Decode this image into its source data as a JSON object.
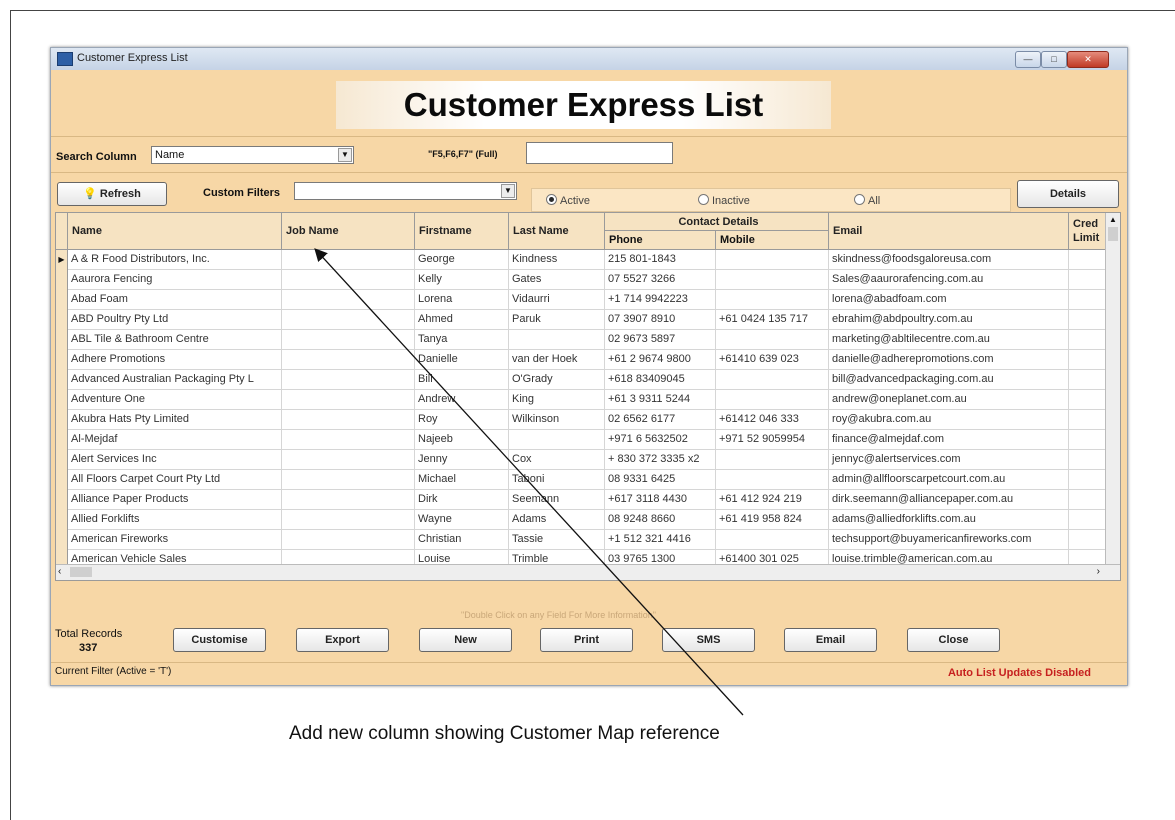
{
  "window": {
    "title": "Customer Express List",
    "header": "Customer Express List",
    "controls": {
      "minimize": "—",
      "maximize": "□",
      "close": "✕"
    }
  },
  "search": {
    "label": "Search Column",
    "column_value": "Name",
    "fkeys_label": "\"F5,F6,F7\" (Full)",
    "text_value": ""
  },
  "toolbar": {
    "refresh_label": "Refresh",
    "custom_filters_label": "Custom Filters",
    "custom_filters_value": "",
    "details_label": "Details"
  },
  "filter_radio": {
    "options": [
      "Active",
      "Inactive",
      "All"
    ],
    "selected": "Active"
  },
  "grid": {
    "columns": {
      "name": "Name",
      "job_name": "Job Name",
      "firstname": "Firstname",
      "last_name": "Last Name",
      "contact_details": "Contact Details",
      "phone": "Phone",
      "mobile": "Mobile",
      "email": "Email",
      "credit_limit": "Cred Limit"
    },
    "rows": [
      {
        "name": "A & R Food Distributors, Inc.",
        "job": "",
        "first": "George",
        "last": "Kindness",
        "phone": "215 801-1843",
        "mobile": "",
        "email": "skindness@foodsgaloreusa.com"
      },
      {
        "name": "Aaurora Fencing",
        "job": "",
        "first": "Kelly",
        "last": "Gates",
        "phone": "07 5527 3266",
        "mobile": "",
        "email": "Sales@aaurorafencing.com.au"
      },
      {
        "name": "Abad Foam",
        "job": "",
        "first": "Lorena",
        "last": "Vidaurri",
        "phone": "+1 714 9942223",
        "mobile": "",
        "email": "lorena@abadfoam.com"
      },
      {
        "name": "ABD Poultry Pty Ltd",
        "job": "",
        "first": "Ahmed",
        "last": "Paruk",
        "phone": "07 3907 8910",
        "mobile": "+61 0424 135 717",
        "email": "ebrahim@abdpoultry.com.au"
      },
      {
        "name": "ABL Tile & Bathroom Centre",
        "job": "",
        "first": "Tanya",
        "last": "",
        "phone": "02 9673 5897",
        "mobile": "",
        "email": "marketing@abltilecentre.com.au"
      },
      {
        "name": "Adhere Promotions",
        "job": "",
        "first": "Danielle",
        "last": "van der Hoek",
        "phone": "+61 2 9674 9800",
        "mobile": "+61410 639 023",
        "email": "danielle@adherepromotions.com"
      },
      {
        "name": "Advanced Australian Packaging Pty L",
        "job": "",
        "first": "Bill",
        "last": "O'Grady",
        "phone": "+618 83409045",
        "mobile": "",
        "email": "bill@advancedpackaging.com.au"
      },
      {
        "name": "Adventure One",
        "job": "",
        "first": "Andrew",
        "last": "King",
        "phone": "+61 3 9311 5244",
        "mobile": "",
        "email": "andrew@oneplanet.com.au"
      },
      {
        "name": "Akubra Hats Pty Limited",
        "job": "",
        "first": "Roy",
        "last": "Wilkinson",
        "phone": "02 6562 6177",
        "mobile": "+61412 046 333",
        "email": "roy@akubra.com.au"
      },
      {
        "name": "Al-Mejdaf",
        "job": "",
        "first": "Najeeb",
        "last": "",
        "phone": "+971 6 5632502",
        "mobile": "+971 52 9059954",
        "email": "finance@almejdaf.com"
      },
      {
        "name": "Alert Services Inc",
        "job": "",
        "first": "Jenny",
        "last": "Cox",
        "phone": "+ 830 372 3335 x2",
        "mobile": "",
        "email": "jennyc@alertservices.com"
      },
      {
        "name": "All Floors Carpet Court Pty Ltd",
        "job": "",
        "first": "Michael",
        "last": "Taboni",
        "phone": "08 9331 6425",
        "mobile": "",
        "email": "admin@allfloorscarpetcourt.com.au"
      },
      {
        "name": "Alliance Paper Products",
        "job": "",
        "first": "Dirk",
        "last": "Seemann",
        "phone": "+617 3118 4430",
        "mobile": "+61 412 924 219",
        "email": "dirk.seemann@alliancepaper.com.au"
      },
      {
        "name": "Allied Forklifts",
        "job": "",
        "first": "Wayne",
        "last": "Adams",
        "phone": "08 9248 8660",
        "mobile": "+61 419 958 824",
        "email": "adams@alliedforklifts.com.au"
      },
      {
        "name": "American Fireworks",
        "job": "",
        "first": "Christian",
        "last": "Tassie",
        "phone": "+1 512 321 4416",
        "mobile": "",
        "email": "techsupport@buyamericanfireworks.com"
      },
      {
        "name": "American Vehicle Sales",
        "job": "",
        "first": "Louise",
        "last": "Trimble",
        "phone": "03 9765 1300",
        "mobile": "+61400 301 025",
        "email": "louise.trimble@american.com.au"
      }
    ]
  },
  "hint": "\"Double Click on any Field For More Information\"",
  "totals": {
    "label": "Total Records",
    "value": "337"
  },
  "buttons": {
    "customise": "Customise",
    "export": "Export",
    "new": "New",
    "print": "Print",
    "sms": "SMS",
    "email": "Email",
    "close": "Close"
  },
  "status": {
    "current_filter": "Current Filter   (Active = 'T')",
    "auto_updates": "Auto List Updates Disabled"
  },
  "annotation": {
    "caption": "Add new column showing Customer Map reference"
  }
}
